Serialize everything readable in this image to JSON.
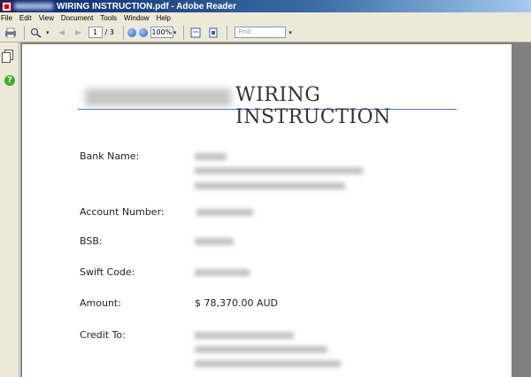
{
  "window": {
    "title": "WIRING INSTRUCTION.pdf - Adobe Reader"
  },
  "menubar": {
    "items": [
      "File",
      "Edit",
      "View",
      "Document",
      "Tools",
      "Window",
      "Help"
    ]
  },
  "toolbar": {
    "page_current": "1",
    "page_total": "/ 3",
    "zoom": "100%",
    "find_placeholder": "Find"
  },
  "document": {
    "title": "WIRING INSTRUCTION",
    "fields": [
      {
        "label": "Bank Name:"
      },
      {
        "label": "Account Number:"
      },
      {
        "label": "BSB:"
      },
      {
        "label": "Swift Code:"
      },
      {
        "label": "Amount:",
        "value": "$ 78,370.00 AUD"
      },
      {
        "label": "Credit To:"
      }
    ]
  }
}
